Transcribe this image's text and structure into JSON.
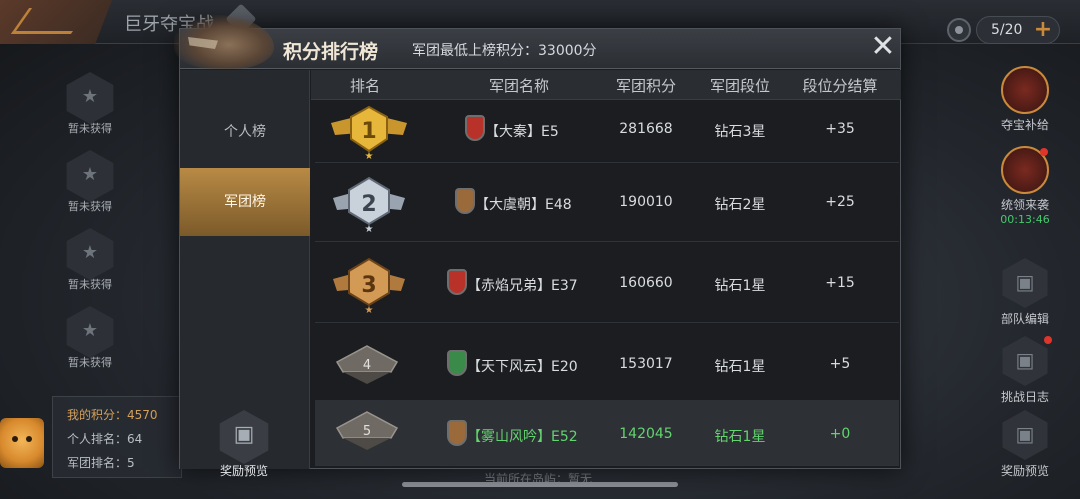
{
  "background": {
    "page_title": "巨牙夺宝战",
    "counter": "5/20",
    "badges": [
      "暂未获得",
      "暂未获得",
      "暂未获得",
      "暂未获得"
    ],
    "stats": {
      "my_score": "我的积分：4570",
      "personal_rank": "个人排名：64",
      "legion_rank": "军团排名：5"
    },
    "side_buttons": [
      {
        "label": "夺宝补给"
      },
      {
        "label": "统领来袭",
        "timer": "00:13:46"
      },
      {
        "label": "部队编辑"
      },
      {
        "label": "挑战日志"
      },
      {
        "label": "奖励预览"
      }
    ],
    "bottom_hint": "当前所在岛屿：暂无"
  },
  "modal": {
    "title": "积分排行榜",
    "subtitle": "军团最低上榜积分：33000分",
    "tabs": [
      {
        "label": "个人榜",
        "active": false
      },
      {
        "label": "军团榜",
        "active": true
      }
    ],
    "reward_preview_label": "奖励预览",
    "columns": [
      "排名",
      "军团名称",
      "军团积分",
      "军团段位",
      "段位分结算"
    ],
    "rows": [
      {
        "rank": "1",
        "name": "【大秦】E5",
        "score": "281668",
        "tier": "钻石3星",
        "settle": "+35",
        "emblem_color": "#b8322a"
      },
      {
        "rank": "2",
        "name": "【大虞朝】E48",
        "score": "190010",
        "tier": "钻石2星",
        "settle": "+25",
        "emblem_color": "#9a6a3a"
      },
      {
        "rank": "3",
        "name": "【赤焰兄弟】E37",
        "score": "160660",
        "tier": "钻石1星",
        "settle": "+15",
        "emblem_color": "#b8322a"
      },
      {
        "rank": "4",
        "name": "【天下风云】E20",
        "score": "153017",
        "tier": "钻石1星",
        "settle": "+5",
        "emblem_color": "#3a8a4a"
      },
      {
        "rank": "5",
        "name": "【雾山风吟】E52",
        "score": "142045",
        "tier": "钻石1星",
        "settle": "+0",
        "emblem_color": "#9a6a3a",
        "mine": true
      }
    ]
  },
  "colors": {
    "accent_gold": "#b88a45",
    "own_row_green": "#62d56e",
    "timer_green": "#45c96b",
    "alert_red": "#e0352b"
  }
}
